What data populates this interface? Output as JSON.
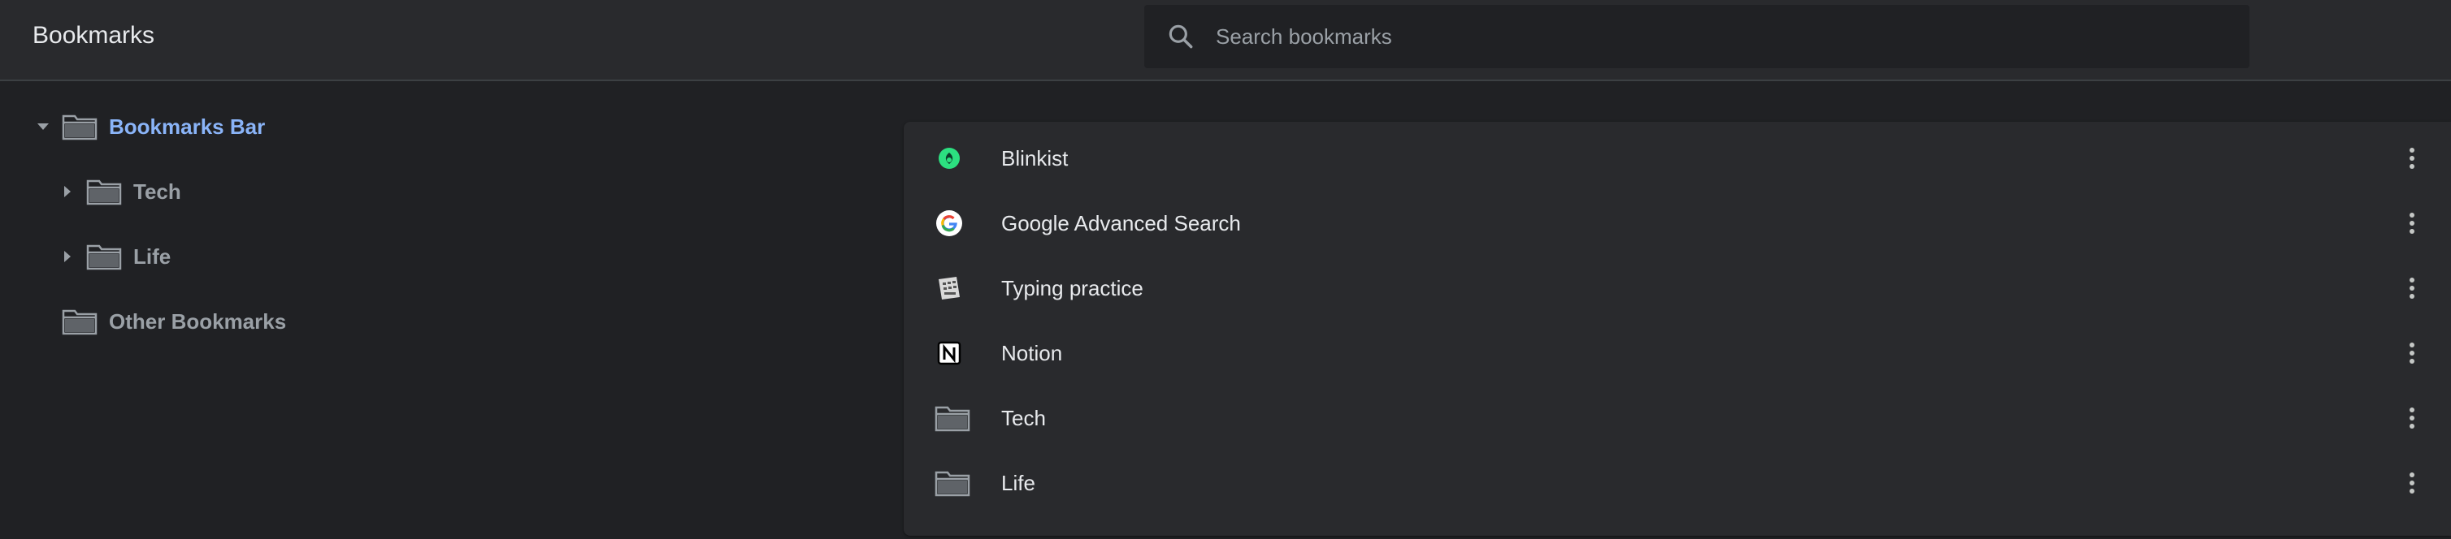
{
  "header": {
    "title": "Bookmarks",
    "search": {
      "placeholder": "Search bookmarks",
      "value": "",
      "icon": "search-icon"
    }
  },
  "tree": {
    "items": [
      {
        "label": "Bookmarks Bar",
        "expanded": true,
        "selected": true,
        "icon": "folder-icon"
      },
      {
        "label": "Tech",
        "expanded": false,
        "selected": false,
        "icon": "folder-icon"
      },
      {
        "label": "Life",
        "expanded": false,
        "selected": false,
        "icon": "folder-icon"
      },
      {
        "label": "Other Bookmarks",
        "selected": false,
        "icon": "folder-icon"
      }
    ]
  },
  "list": {
    "items": [
      {
        "title": "Blinkist",
        "icon": "blinkist-favicon",
        "menu_icon": "more-vert-icon"
      },
      {
        "title": "Google Advanced Search",
        "icon": "google-favicon",
        "menu_icon": "more-vert-icon"
      },
      {
        "title": "Typing practice",
        "icon": "typing-practice-favicon",
        "menu_icon": "more-vert-icon"
      },
      {
        "title": "Notion",
        "icon": "notion-favicon",
        "menu_icon": "more-vert-icon"
      },
      {
        "title": "Tech",
        "icon": "folder-icon",
        "menu_icon": "more-vert-icon"
      },
      {
        "title": "Life",
        "icon": "folder-icon",
        "menu_icon": "more-vert-icon"
      }
    ]
  },
  "colors": {
    "background": "#202124",
    "toolbar": "#292a2d",
    "card": "#292a2d",
    "selected_text": "#8ab4f8",
    "primary_text": "#e8eaed",
    "secondary_text": "#9aa0a6",
    "blinkist_green": "#2ce080"
  }
}
